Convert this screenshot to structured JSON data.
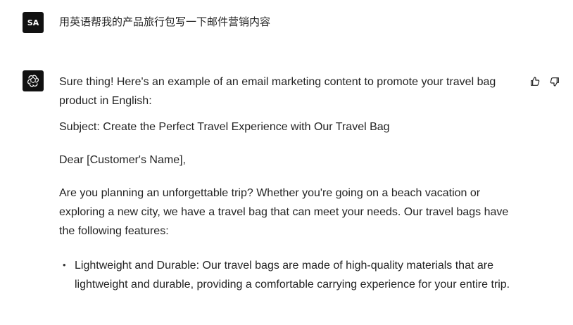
{
  "user_message": {
    "avatar_text": "SA",
    "text": "用英语帮我的产品旅行包写一下邮件营销内容"
  },
  "assistant_message": {
    "intro": "Sure thing! Here's an example of an email marketing content to promote your travel bag product in English:",
    "subject": "Subject: Create the Perfect Travel Experience with Our Travel Bag",
    "greeting": "Dear [Customer's Name],",
    "body": "Are you planning an unforgettable trip? Whether you're going on a beach vacation or exploring a new city, we have a travel bag that can meet your needs. Our travel bags have the following features:",
    "features": [
      "Lightweight and Durable: Our travel bags are made of high-quality materials that are lightweight and durable, providing a comfortable carrying experience for your entire trip."
    ]
  },
  "icons": {
    "user_avatar": "user-avatar-icon",
    "assistant_avatar": "openai-logo-icon",
    "thumbs_up": "thumbs-up-icon",
    "thumbs_down": "thumbs-down-icon"
  },
  "colors": {
    "background": "#ffffff",
    "text": "#242424",
    "avatar_background": "#111111",
    "avatar_foreground": "#ffffff"
  }
}
